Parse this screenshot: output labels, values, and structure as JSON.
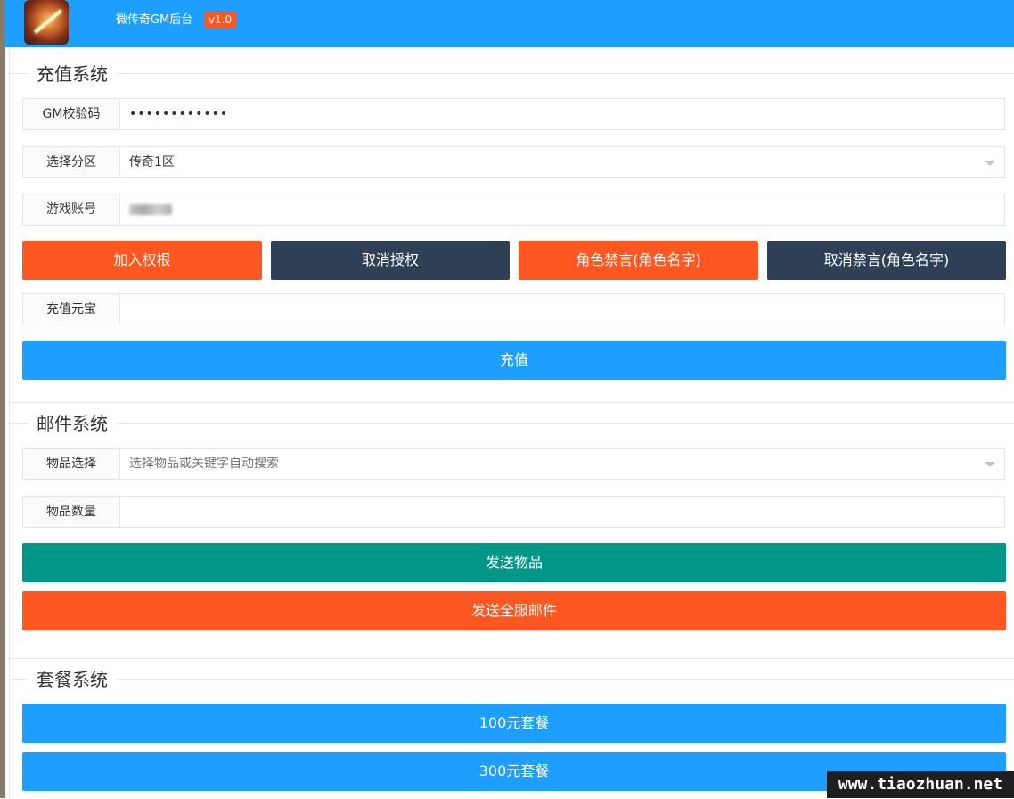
{
  "header": {
    "title": "微传奇GM后台",
    "version": "v1.0"
  },
  "recharge": {
    "legend": "充值系统",
    "gm_code_label": "GM校验码",
    "gm_code_value": "••••••••••••",
    "zone_label": "选择分区",
    "zone_value": "传奇1区",
    "account_label": "游戏账号",
    "grant_button": "加入权根",
    "revoke_button": "取消授权",
    "mute_button": "角色禁言(角色名字)",
    "unmute_button": "取消禁言(角色名字)",
    "yuanbao_label": "充值元宝",
    "recharge_button": "充值"
  },
  "mail": {
    "legend": "邮件系统",
    "item_label": "物品选择",
    "item_placeholder": "选择物品或关键字自动搜索",
    "quantity_label": "物品数量",
    "send_item_button": "发送物品",
    "send_all_button": "发送全服邮件"
  },
  "package": {
    "legend": "套餐系统",
    "package_100": "100元套餐",
    "package_300": "300元套餐"
  },
  "watermark": "www.tiaozhuan.net"
}
